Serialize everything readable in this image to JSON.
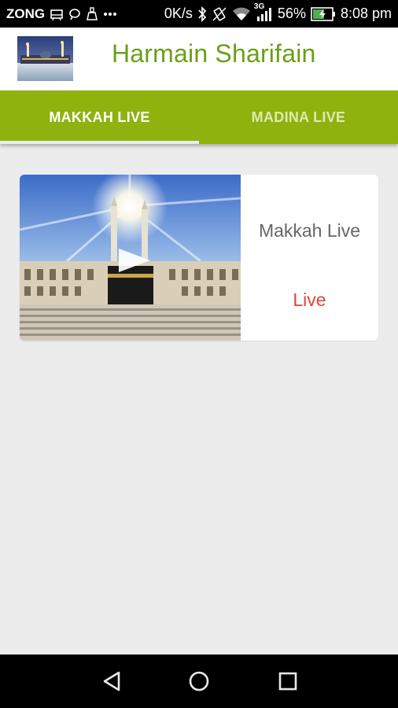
{
  "status_bar": {
    "carrier": "ZONG",
    "net_speed": "0K/s",
    "network_type": "3G",
    "battery": "56%",
    "time": "8:08 pm"
  },
  "header": {
    "title": "Harmain Sharifain"
  },
  "tabs": [
    {
      "label": "MAKKAH LIVE",
      "active": true
    },
    {
      "label": "MADINA LIVE",
      "active": false
    }
  ],
  "card": {
    "title": "Makkah Live",
    "status": "Live"
  },
  "colors": {
    "accent_green": "#8fb20f",
    "title_green": "#6b9e1a",
    "live_red": "#e0463a"
  }
}
